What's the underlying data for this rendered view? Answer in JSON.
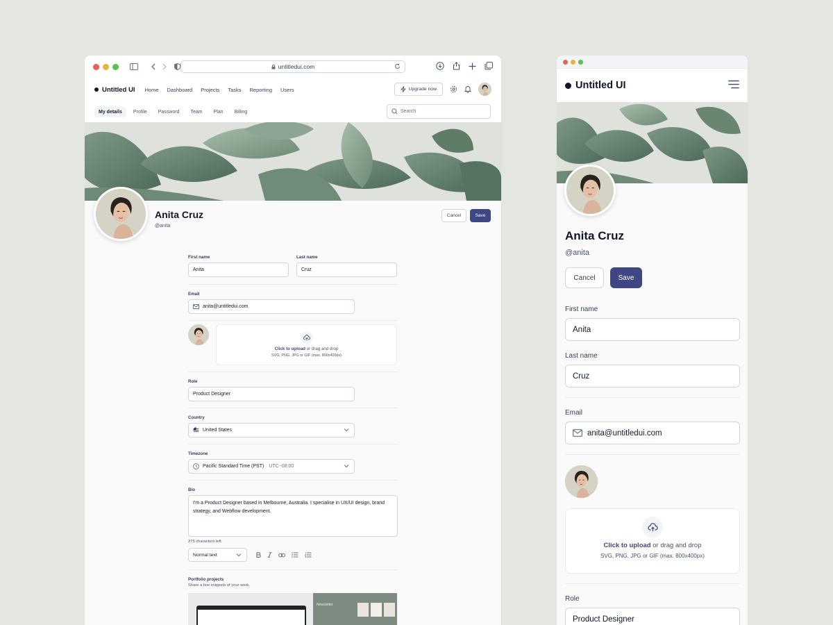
{
  "colors": {
    "background": "#e4e6e2",
    "primary": "#3e4784",
    "border": "#d0d5dd",
    "text": "#101828"
  },
  "browser": {
    "url": "untitledui.com"
  },
  "desktop": {
    "brand": "Untitled UI",
    "nav": [
      "Home",
      "Dashboard",
      "Projects",
      "Tasks",
      "Reporting",
      "Users"
    ],
    "upgrade_label": "Upgrade now",
    "subtabs": [
      "My details",
      "Profile",
      "Password",
      "Team",
      "Plan",
      "Billing"
    ],
    "search_placeholder": "Search",
    "profile": {
      "name": "Anita Cruz",
      "handle": "@anita"
    },
    "cancel_label": "Cancel",
    "save_label": "Save",
    "form": {
      "first_name_label": "First name",
      "first_name": "Anita",
      "last_name_label": "Last name",
      "last_name": "Cruz",
      "email_label": "Email",
      "email": "anita@untitledui.com",
      "upload_action": "Click to upload",
      "upload_rest": " or drag and drop",
      "upload_hint": "SVG, PNG, JPG or GIF (max. 800x400px)",
      "role_label": "Role",
      "role": "Product Designer",
      "country_label": "Country",
      "country": "United States",
      "timezone_label": "Timezone",
      "timezone": "Pacific Standard Time (PST)",
      "timezone_offset": "UTC−08:00",
      "bio_label": "Bio",
      "bio": "I'm a Product Designer based in Melbourne, Australia. I specialise in UX/UI design, brand strategy, and Webflow development.",
      "chars_left": "275 characters left",
      "text_style": "Normal text",
      "portfolio_title": "Portfolio projects",
      "portfolio_sub": "Share a few snippets of your work.",
      "portfolio_newsletter": "Newsletter"
    }
  },
  "mobile": {
    "brand": "Untitled UI",
    "profile": {
      "name": "Anita Cruz",
      "handle": "@anita"
    },
    "cancel_label": "Cancel",
    "save_label": "Save",
    "first_name_label": "First name",
    "first_name": "Anita",
    "last_name_label": "Last name",
    "last_name": "Cruz",
    "email_label": "Email",
    "email": "anita@untitledui.com",
    "upload_action": "Click to upload",
    "upload_rest": " or drag and drop",
    "upload_hint": "SVG, PNG, JPG or GIF (max. 800x400px)",
    "role_label": "Role",
    "role": "Product Designer"
  },
  "icons": [
    "sidebar-icon",
    "chevron-left-icon",
    "chevron-right-icon",
    "shield-icon",
    "lock-icon",
    "reload-icon",
    "download-icon",
    "share-icon",
    "plus-icon",
    "tabs-icon",
    "lightning-icon",
    "gear-icon",
    "bell-icon",
    "search-icon",
    "mail-icon",
    "upload-cloud-icon",
    "flag-us-icon",
    "clock-icon",
    "chevron-down-icon",
    "bold-icon",
    "italic-icon",
    "link-icon",
    "bullet-list-icon",
    "numbered-list-icon",
    "hamburger-menu-icon"
  ]
}
